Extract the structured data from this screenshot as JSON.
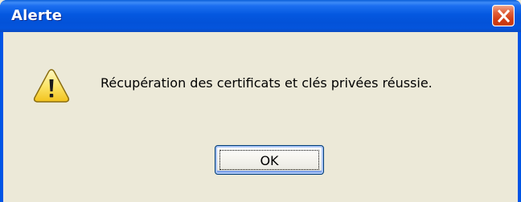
{
  "window": {
    "title": "Alerte",
    "close_icon": "close-icon",
    "title_color": "#0055e5",
    "body_color": "#ece9d8"
  },
  "dialog": {
    "icon": "warning-icon",
    "message": "Récupération des certificats et clés privées réussie.",
    "ok_label": "OK"
  }
}
